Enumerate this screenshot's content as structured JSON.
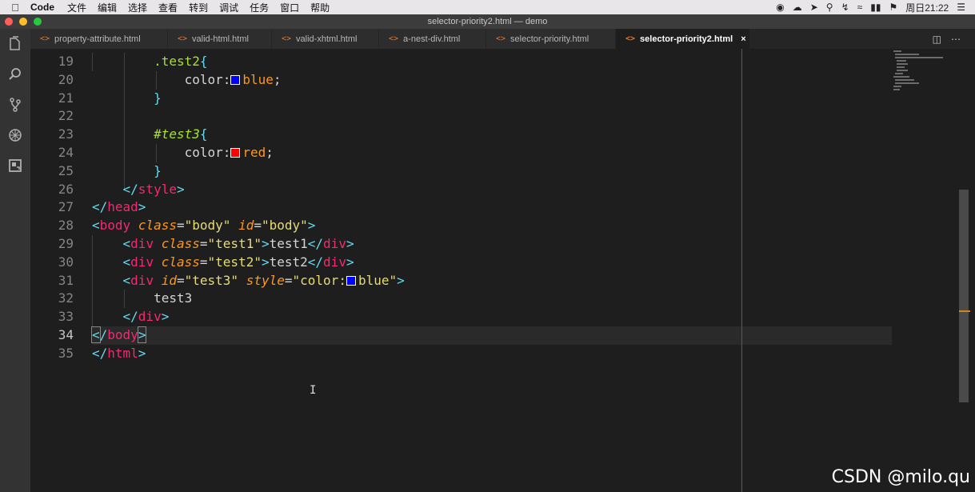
{
  "menubar": {
    "app_name": "Code",
    "menus": [
      "文件",
      "编辑",
      "选择",
      "查看",
      "转到",
      "调试",
      "任务",
      "窗口",
      "帮助"
    ],
    "clock": "周日21:22",
    "colors": {
      "background": "#e8e6e8"
    }
  },
  "window": {
    "title": "selector-priority2.html — demo"
  },
  "tabs": [
    {
      "label": "property-attribute.html",
      "icon": "code-angle-icon"
    },
    {
      "label": "valid-html.html",
      "icon": "code-angle-icon"
    },
    {
      "label": "valid-xhtml.html",
      "icon": "code-angle-icon"
    },
    {
      "label": "a-nest-div.html",
      "icon": "code-angle-icon"
    },
    {
      "label": "selector-priority.html",
      "icon": "code-angle-icon"
    },
    {
      "label": "selector-priority2.html",
      "icon": "code-angle-icon",
      "active": true,
      "close": "×"
    }
  ],
  "activity_bar": [
    "explorer-icon",
    "search-icon",
    "source-control-icon",
    "debug-icon",
    "extensions-icon"
  ],
  "editor": {
    "line_numbers": [
      "19",
      "20",
      "21",
      "22",
      "23",
      "24",
      "25",
      "26",
      "27",
      "28",
      "29",
      "30",
      "31",
      "32",
      "33",
      "34",
      "35"
    ],
    "current_line": "34",
    "lines": {
      "l19": {
        "sel": ".test2",
        "open": "{"
      },
      "l20": {
        "prop": "color:",
        "val": "blue",
        "end": ";"
      },
      "l21": {
        "close": "}"
      },
      "l23": {
        "sel": "#test3",
        "open": "{"
      },
      "l24": {
        "prop": "color:",
        "val": "red",
        "end": ";"
      },
      "l25": {
        "close": "}"
      },
      "l26": {
        "tag": "style"
      },
      "l27": {
        "tag": "head"
      },
      "l28": {
        "tag": "body",
        "attr1": "class",
        "val1": "\"body\"",
        "attr2": "id",
        "val2": "\"body\""
      },
      "l29": {
        "tag": "div",
        "attr": "class",
        "val": "\"test1\"",
        "text": "test1",
        "close_tag": "div"
      },
      "l30": {
        "tag": "div",
        "attr": "class",
        "val": "\"test2\"",
        "text": "test2",
        "close_tag": "div"
      },
      "l31": {
        "tag": "div",
        "attr1": "id",
        "val1": "\"test3\"",
        "attr2": "style",
        "val2_pre": "\"color:",
        "val2_post": "blue\""
      },
      "l32": {
        "text": "test3"
      },
      "l33": {
        "tag": "div"
      },
      "l34": {
        "tag": "body"
      },
      "l35": {
        "tag": "html"
      }
    },
    "swatch_colors": {
      "blue": "#0000ff",
      "red": "#ff0000"
    }
  },
  "watermark": "CSDN @milo.qu"
}
